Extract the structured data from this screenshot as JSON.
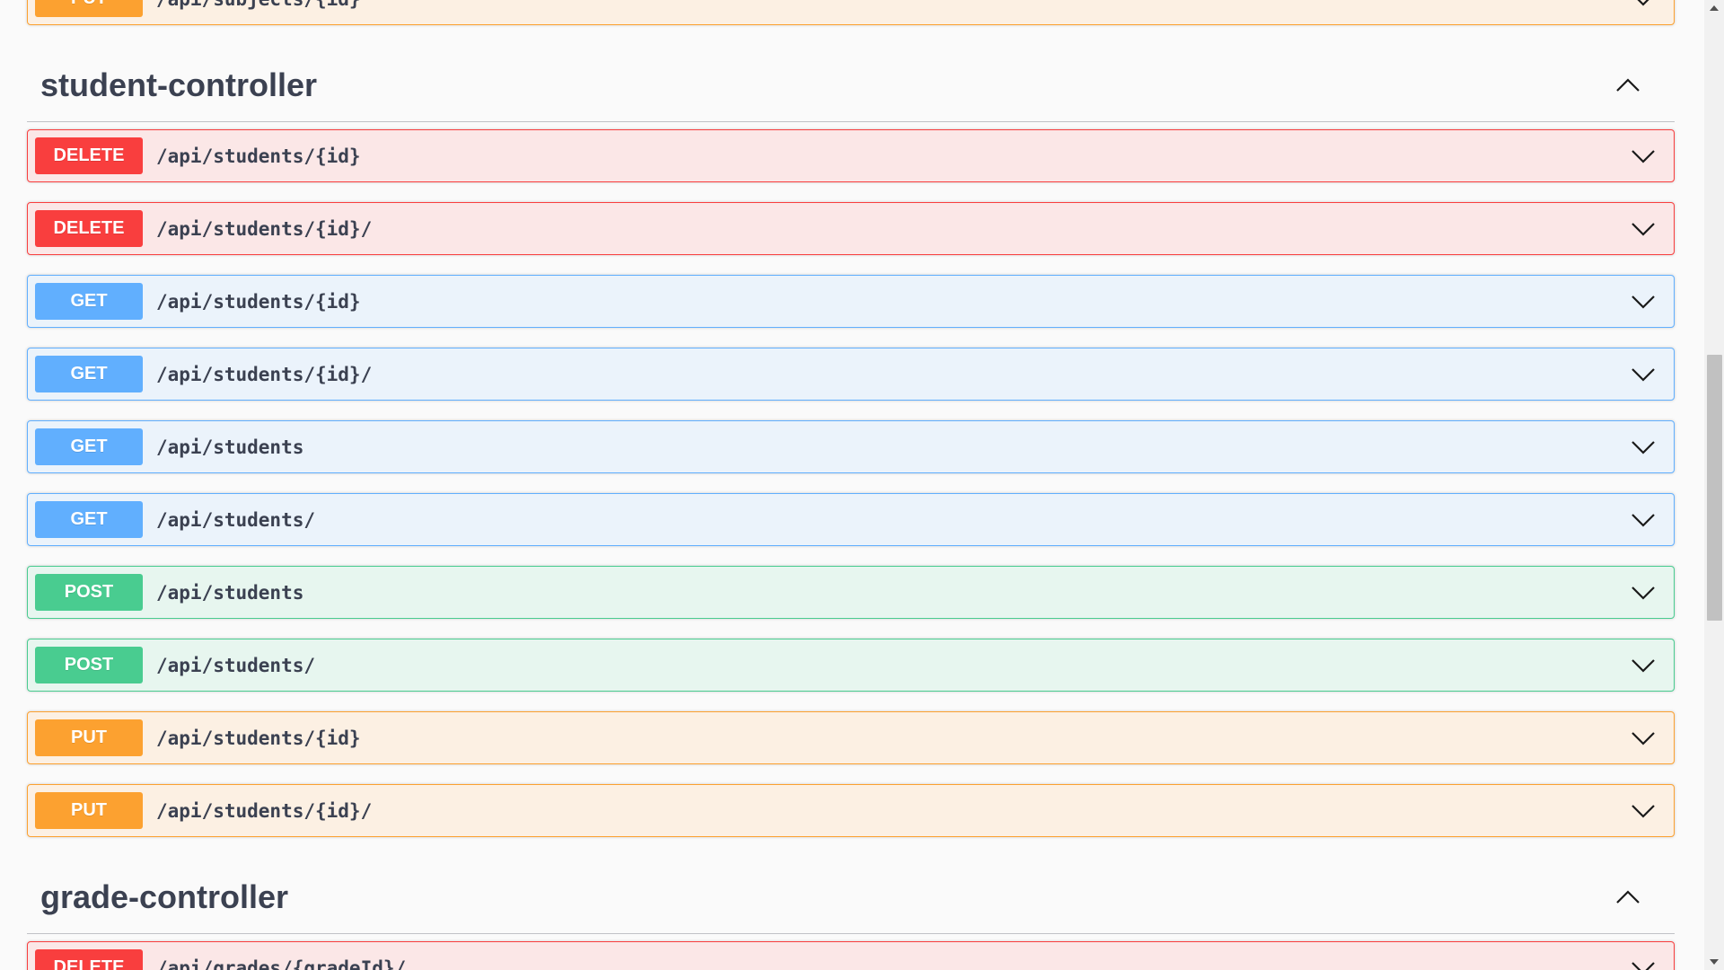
{
  "prev_group": {
    "ops": [
      {
        "method": "PUT",
        "path": "/api/subjects/{id}",
        "kind": "put"
      }
    ]
  },
  "groups": [
    {
      "title": "student-controller",
      "ops": [
        {
          "method": "DELETE",
          "path": "/api/students/{id}",
          "kind": "delete"
        },
        {
          "method": "DELETE",
          "path": "/api/students/{id}/",
          "kind": "delete"
        },
        {
          "method": "GET",
          "path": "/api/students/{id}",
          "kind": "get"
        },
        {
          "method": "GET",
          "path": "/api/students/{id}/",
          "kind": "get"
        },
        {
          "method": "GET",
          "path": "/api/students",
          "kind": "get"
        },
        {
          "method": "GET",
          "path": "/api/students/",
          "kind": "get"
        },
        {
          "method": "POST",
          "path": "/api/students",
          "kind": "post"
        },
        {
          "method": "POST",
          "path": "/api/students/",
          "kind": "post"
        },
        {
          "method": "PUT",
          "path": "/api/students/{id}",
          "kind": "put"
        },
        {
          "method": "PUT",
          "path": "/api/students/{id}/",
          "kind": "put"
        }
      ]
    },
    {
      "title": "grade-controller",
      "ops": [
        {
          "method": "DELETE",
          "path": "/api/grades/{gradeId}/",
          "kind": "delete"
        }
      ]
    }
  ],
  "icons": {
    "row_expand": "chevron-down-icon",
    "section_collapse": "chevron-up-icon"
  },
  "colors": {
    "get": "#61affe",
    "post": "#49cc90",
    "put": "#fca130",
    "delete": "#f93e3e"
  }
}
